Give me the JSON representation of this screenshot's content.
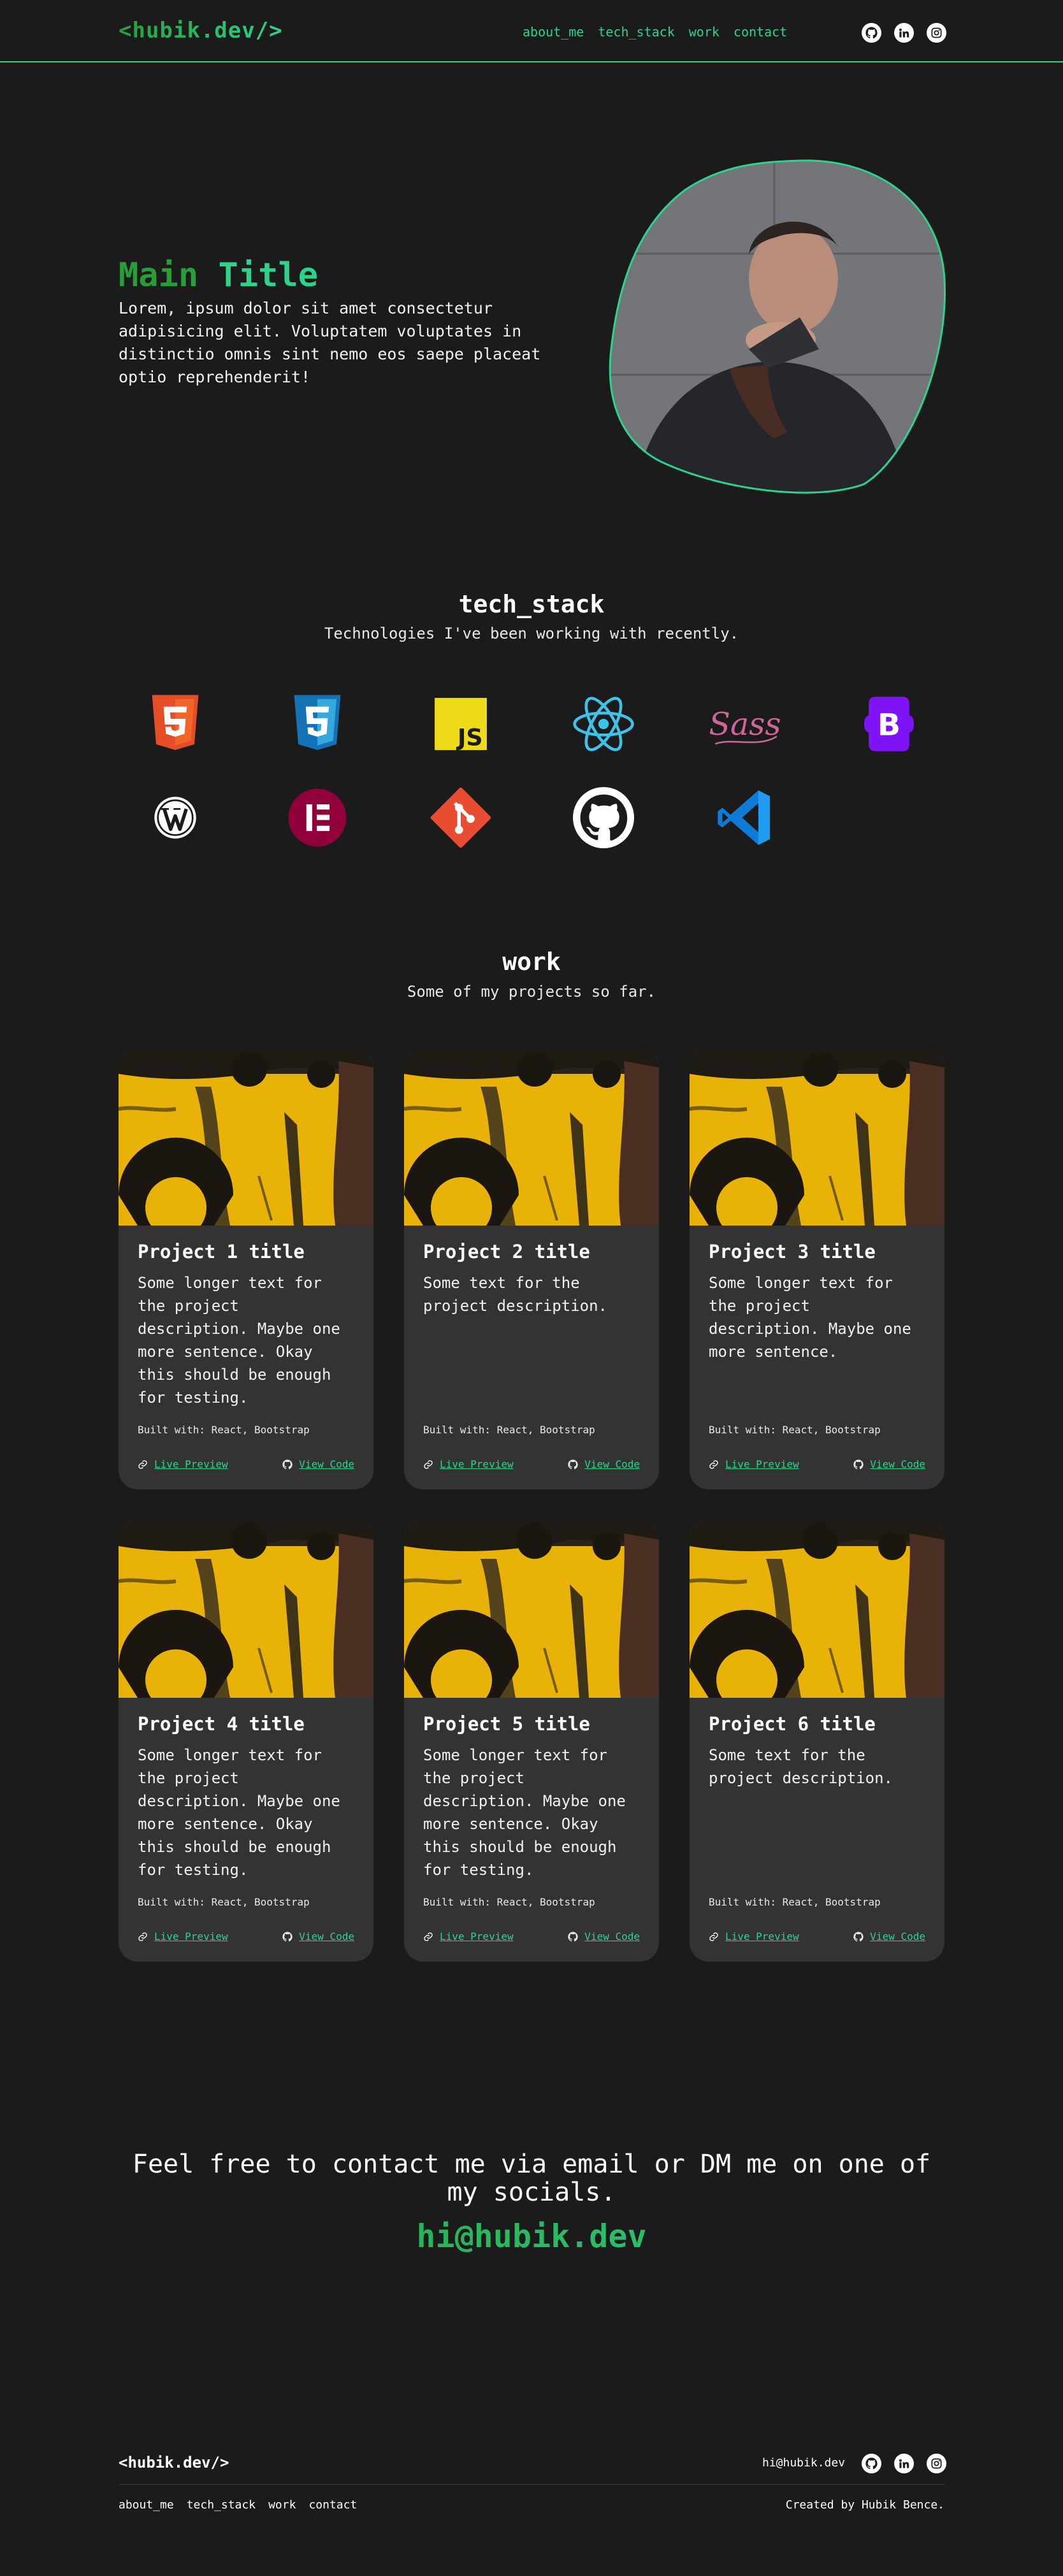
{
  "header": {
    "logo": "<hubik.dev/>",
    "nav": [
      "about_me",
      "tech_stack",
      "work",
      "contact"
    ],
    "social_icons": [
      "github-icon",
      "linkedin-icon",
      "instagram-icon"
    ]
  },
  "hero": {
    "title_word1": "Main",
    "title_word2": "Title",
    "text": "Lorem, ipsum dolor sit amet consectetur adipisicing elit. Voluptatem voluptates in distinctio omnis sint nemo eos saepe placeat optio reprehenderit!"
  },
  "tech_stack": {
    "title": "tech_stack",
    "subtitle": "Technologies I've been working with recently.",
    "icons": [
      "html5-icon",
      "css3-icon",
      "javascript-icon",
      "react-icon",
      "sass-icon",
      "bootstrap-icon",
      "wordpress-icon",
      "elementor-icon",
      "git-icon",
      "github-icon",
      "vscode-icon"
    ],
    "js_label": "JS",
    "sass_label": "Sass",
    "bootstrap_label": "B"
  },
  "work": {
    "title": "work",
    "subtitle": "Some of my projects so far.",
    "projects": [
      {
        "title": "Project 1 title",
        "desc": "Some longer text for the project description. Maybe one more sentence. Okay this should be enough for testing.",
        "built": "Built with: React, Bootstrap",
        "live": "Live Preview",
        "code": "View Code"
      },
      {
        "title": "Project 2 title",
        "desc": "Some text for the project description.",
        "built": "Built with: React, Bootstrap",
        "live": "Live Preview",
        "code": "View Code"
      },
      {
        "title": "Project 3 title",
        "desc": "Some longer text for the project description. Maybe one more sentence.",
        "built": "Built with: React, Bootstrap",
        "live": "Live Preview",
        "code": "View Code"
      },
      {
        "title": "Project 4 title",
        "desc": "Some longer text for the project description. Maybe one more sentence. Okay this should be enough for testing.",
        "built": "Built with: React, Bootstrap",
        "live": "Live Preview",
        "code": "View Code"
      },
      {
        "title": "Project 5 title",
        "desc": "Some longer text for the project description. Maybe one more sentence. Okay this should be enough for testing.",
        "built": "Built with: React, Bootstrap",
        "live": "Live Preview",
        "code": "View Code"
      },
      {
        "title": "Project 6 title",
        "desc": "Some text for the project description.",
        "built": "Built with: React, Bootstrap",
        "live": "Live Preview",
        "code": "View Code"
      }
    ]
  },
  "contact": {
    "text": "Feel free to contact me via email or DM me on one of my socials.",
    "email": "hi@hubik.dev"
  },
  "footer": {
    "logo": "<hubik.dev/>",
    "email": "hi@hubik.dev",
    "nav": [
      "about_me",
      "tech_stack",
      "work",
      "contact"
    ],
    "credit": "Created by Hubik Bence."
  },
  "colors": {
    "background": "#1b1b1b",
    "card": "#333333",
    "accent_green": "#2bd48a",
    "accent_dark_green": "#2a9d3a"
  }
}
